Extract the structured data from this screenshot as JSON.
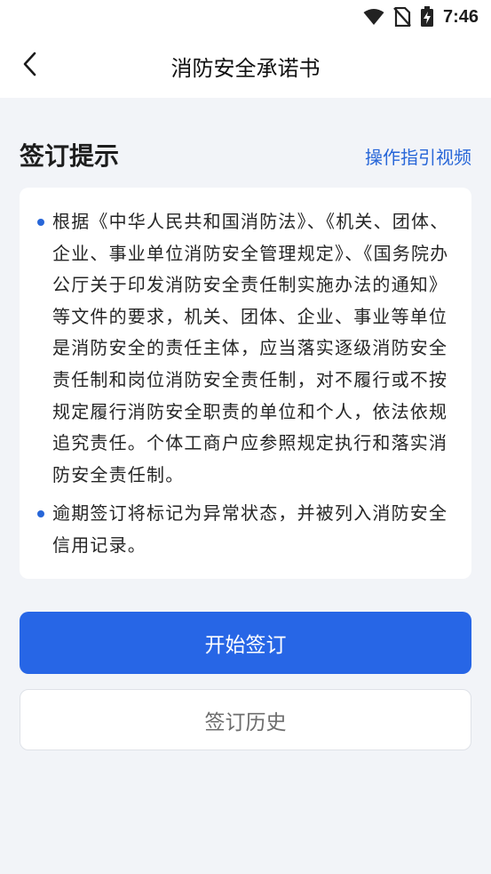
{
  "status_bar": {
    "time": "7:46",
    "icons": [
      "wifi-icon",
      "no-sim-icon",
      "battery-charging-icon"
    ]
  },
  "header": {
    "title": "消防安全承诺书",
    "back_icon": "chevron-left-icon"
  },
  "section": {
    "title": "签订提示",
    "guide_link": "操作指引视频"
  },
  "notice": {
    "items": [
      "根据《中华人民共和国消防法》、《机关、团体、企业、事业单位消防安全管理规定》、《国务院办公厅关于印发消防安全责任制实施办法的通知》等文件的要求，机关、团体、企业、事业等单位是消防安全的责任主体，应当落实逐级消防安全责任制和岗位消防安全责任制，对不履行或不按规定履行消防安全职责的单位和个人，依法依规追究责任。个体工商户应参照规定执行和落实消防安全责任制。",
      "逾期签订将标记为异常状态，并被列入消防安全信用记录。"
    ]
  },
  "actions": {
    "start_label": "开始签订",
    "history_label": "签订历史"
  },
  "colors": {
    "accent": "#2766e6",
    "link": "#2766d8",
    "background": "#f2f4f8"
  }
}
